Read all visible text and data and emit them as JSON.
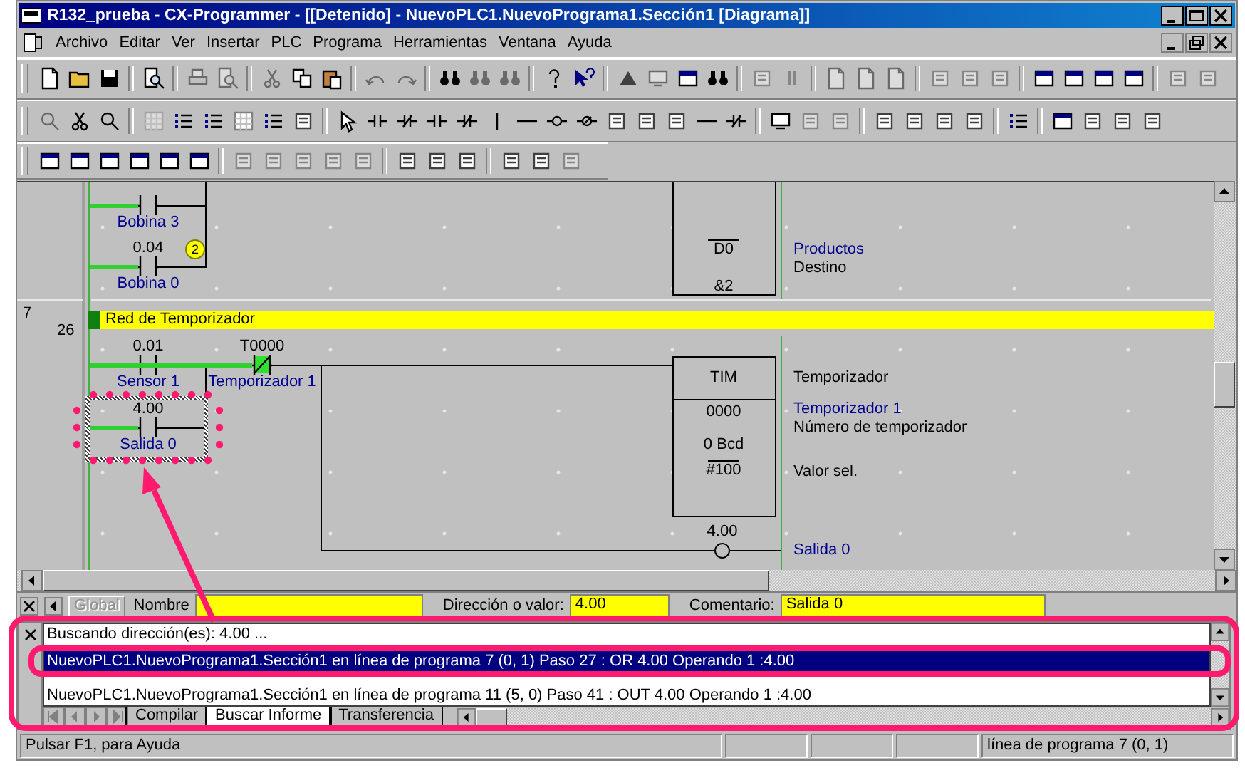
{
  "window": {
    "title": "R132_prueba - CX-Programmer - [[Detenido] - NuevoPLC1.NuevoPrograma1.Sección1 [Diagrama]]"
  },
  "menu": [
    "Archivo",
    "Editar",
    "Ver",
    "Insertar",
    "PLC",
    "Programa",
    "Herramientas",
    "Ventana",
    "Ayuda"
  ],
  "diagram": {
    "rungs": [
      {
        "contacts": [
          {
            "comment": "Bobina 3",
            "negated": false,
            "energized": false
          },
          {
            "address": "0.04",
            "comment": "Bobina 0",
            "badge": "2",
            "negated": false,
            "energized": false
          }
        ],
        "instruction": {
          "operands": [
            "D0",
            "&2"
          ]
        },
        "notes": [
          {
            "symbol": "Productos",
            "description": "Destino"
          }
        ]
      },
      {
        "number": "7",
        "step": "26",
        "title": "Red de Temporizador",
        "contacts": [
          {
            "address": "0.01",
            "comment": "Sensor 1",
            "negated": false,
            "energized": false
          },
          {
            "address": "T0000",
            "comment": "Temporizador 1",
            "negated": true,
            "energized": true
          },
          {
            "address": "4.00",
            "comment": "Salida 0",
            "negated": false,
            "energized": false,
            "selected": true
          }
        ],
        "instruction": {
          "name": "TIM",
          "operands": [
            "0000",
            "0 Bcd",
            "#100"
          ]
        },
        "notes": [
          {
            "description": "Temporizador"
          },
          {
            "symbol": "Temporizador 1",
            "description": "Número de temporizador"
          },
          {
            "description": "Valor sel."
          }
        ],
        "coil": {
          "address": "4.00",
          "symbol": "Salida 0"
        }
      }
    ]
  },
  "find_bar": {
    "scope": "Global",
    "name_label": "Nombre",
    "address_label": "Dirección o valor:",
    "address_value": "4.00",
    "comment_label": "Comentario:",
    "comment_value": "Salida 0"
  },
  "output": {
    "lines": [
      {
        "text": "Buscando dirección(es): 4.00 ...",
        "selected": false
      },
      {
        "text": "NuevoPLC1.NuevoPrograma1.Sección1 en línea de programa 7 (0, 1) Paso 27 : OR 4.00 Operando 1 :4.00",
        "selected": true
      },
      {
        "text": "NuevoPLC1.NuevoPrograma1.Sección1 en línea de programa 11 (5, 0) Paso 41 : OUT 4.00 Operando 1 :4.00",
        "selected": false
      }
    ],
    "tabs": [
      {
        "label": "Compilar",
        "selected": false
      },
      {
        "label": "Buscar Informe",
        "selected": true
      },
      {
        "label": "Transferencia",
        "selected": false
      }
    ]
  },
  "status_bar": {
    "help": "Pulsar F1, para Ayuda",
    "position": "línea de programa 7 (0, 1)"
  }
}
